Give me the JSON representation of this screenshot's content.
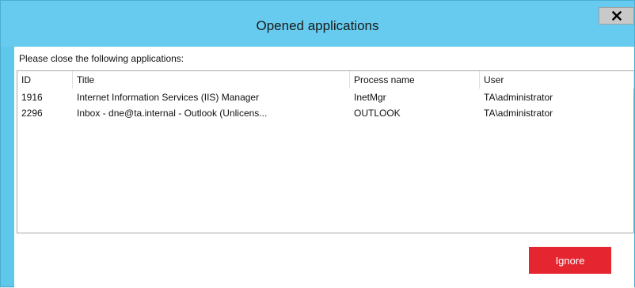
{
  "window": {
    "title": "Opened applications"
  },
  "prompt": "Please close the following applications:",
  "table": {
    "columns": [
      "ID",
      "Title",
      "Process name",
      "User"
    ],
    "rows": [
      [
        "1916",
        "Internet Information Services (IIS) Manager",
        "InetMgr",
        "TA\\administrator"
      ],
      [
        "2296",
        "Inbox - dne@ta.internal - Outlook (Unlicens...",
        "OUTLOOK",
        "TA\\administrator"
      ]
    ]
  },
  "buttons": {
    "ignore_label": "Ignore"
  },
  "colors": {
    "title_bar": "#66cbee",
    "ignore_button": "#e52530",
    "close_button": "#c9c9c9"
  },
  "icons": {
    "close": "close-icon"
  }
}
